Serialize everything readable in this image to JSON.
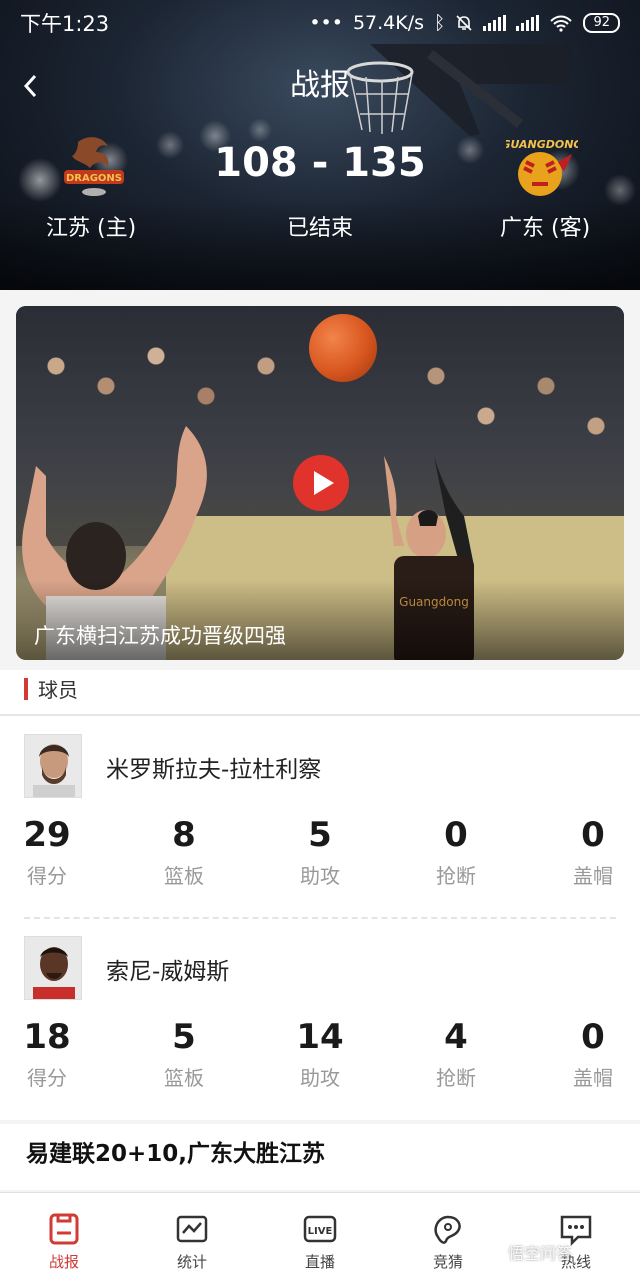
{
  "status_bar": {
    "time": "下午1:23",
    "network_speed": "57.4K/s",
    "battery": "92",
    "icons": [
      "bluetooth-icon",
      "mute-icon",
      "signal-icon",
      "signal-icon",
      "wifi-icon",
      "battery-icon"
    ]
  },
  "nav": {
    "title": "战报",
    "back_icon": "chevron-left-icon"
  },
  "game": {
    "score": "108 - 135",
    "status": "已结束",
    "home_team": "江苏 (主)",
    "away_team": "广东 (客)",
    "home_logo": "jiangsu-dragons-logo",
    "away_logo": "guangdong-tigers-logo"
  },
  "video": {
    "caption": "广东横扫江苏成功晋级四强",
    "play_icon": "play-icon"
  },
  "players_section": {
    "title": "球员",
    "players": [
      {
        "name": "米罗斯拉夫-拉杜利察",
        "stats": [
          {
            "value": "29",
            "label": "得分"
          },
          {
            "value": "8",
            "label": "篮板"
          },
          {
            "value": "5",
            "label": "助攻"
          },
          {
            "value": "0",
            "label": "抢断"
          },
          {
            "value": "0",
            "label": "盖帽"
          }
        ]
      },
      {
        "name": "索尼-威姆斯",
        "stats": [
          {
            "value": "18",
            "label": "得分"
          },
          {
            "value": "5",
            "label": "篮板"
          },
          {
            "value": "14",
            "label": "助攻"
          },
          {
            "value": "4",
            "label": "抢断"
          },
          {
            "value": "0",
            "label": "盖帽"
          }
        ]
      }
    ]
  },
  "news": {
    "title": "易建联20+10,广东大胜江苏"
  },
  "tabbar": {
    "tabs": [
      {
        "label": "战报",
        "icon": "report-icon",
        "active": true
      },
      {
        "label": "统计",
        "icon": "chart-icon",
        "active": false
      },
      {
        "label": "直播",
        "icon": "live-icon",
        "active": false
      },
      {
        "label": "竞猜",
        "icon": "guess-icon",
        "active": false
      },
      {
        "label": "热线",
        "icon": "chat-icon",
        "active": false
      }
    ]
  },
  "watermark": "悟空问答",
  "colors": {
    "accent": "#d23a34",
    "header_bg": "#1c2533"
  }
}
